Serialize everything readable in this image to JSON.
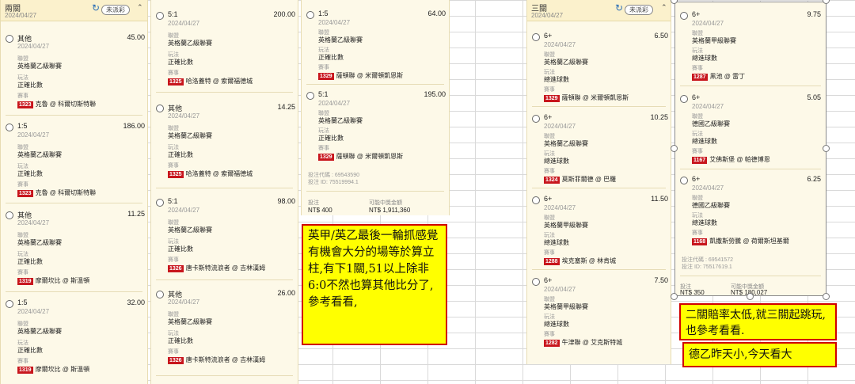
{
  "panels": [
    {
      "title": "兩關",
      "date": "2024/04/27",
      "status": "未派彩",
      "legs": [
        {
          "pick": "其他",
          "odds": "45.00",
          "date": "2024/04/27",
          "league_label": "聯盟",
          "league": "英格蘭乙級聯賽",
          "play_label": "玩法",
          "play": "正確比數",
          "match_label": "賽事",
          "match_id": "1323",
          "match": "克魯 @ 科爾切斯特聯"
        },
        {
          "pick": "1:5",
          "odds": "186.00",
          "date": "2024/04/27",
          "league_label": "聯盟",
          "league": "英格蘭乙級聯賽",
          "play_label": "玩法",
          "play": "正確比數",
          "match_label": "賽事",
          "match_id": "1323",
          "match": "克魯 @ 科爾切斯特聯"
        },
        {
          "pick": "其他",
          "odds": "11.25",
          "date": "2024/04/27",
          "league_label": "聯盟",
          "league": "英格蘭乙級聯賽",
          "play_label": "玩法",
          "play": "正確比數",
          "match_label": "賽事",
          "match_id": "1319",
          "match": "摩爾坎比 @ 斯溫頓"
        },
        {
          "pick": "1:5",
          "odds": "32.00",
          "date": "2024/04/27",
          "league_label": "聯盟",
          "league": "英格蘭乙級聯賽",
          "play_label": "玩法",
          "play": "正確比數",
          "match_label": "賽事",
          "match_id": "1319",
          "match": "摩爾坎比 @ 斯溫頓"
        }
      ]
    },
    {
      "legs": [
        {
          "pick": "5:1",
          "odds": "200.00",
          "date": "2024/04/27",
          "league_label": "聯盟",
          "league": "英格蘭乙級聯賽",
          "play_label": "玩法",
          "play": "正確比數",
          "match_label": "賽事",
          "match_id": "1325",
          "match": "哈洛蓋特 @ 索爾福德城"
        },
        {
          "pick": "其他",
          "odds": "14.25",
          "date": "2024/04/27",
          "league_label": "聯盟",
          "league": "英格蘭乙級聯賽",
          "play_label": "玩法",
          "play": "正確比數",
          "match_label": "賽事",
          "match_id": "1325",
          "match": "哈洛蓋特 @ 索爾福德城"
        },
        {
          "pick": "5:1",
          "odds": "98.00",
          "date": "2024/04/27",
          "league_label": "聯盟",
          "league": "英格蘭乙級聯賽",
          "play_label": "玩法",
          "play": "正確比數",
          "match_label": "賽事",
          "match_id": "1326",
          "match": "唐卡斯特流浪者 @ 吉林漢姆"
        },
        {
          "pick": "其他",
          "odds": "26.00",
          "date": "2024/04/27",
          "league_label": "聯盟",
          "league": "英格蘭乙級聯賽",
          "play_label": "玩法",
          "play": "正確比數",
          "match_label": "賽事",
          "match_id": "1326",
          "match": "唐卡斯特流浪者 @ 吉林漢姆"
        }
      ]
    },
    {
      "legs": [
        {
          "pick": "1:5",
          "odds": "64.00",
          "date": "2024/04/27",
          "league_label": "聯盟",
          "league": "英格蘭乙級聯賽",
          "play_label": "玩法",
          "play": "正確比數",
          "match_label": "賽事",
          "match_id": "1329",
          "match": "薩頓聯 @ 米爾頓凱恩斯"
        },
        {
          "pick": "5:1",
          "odds": "195.00",
          "date": "2024/04/27",
          "league_label": "聯盟",
          "league": "英格蘭乙級聯賽",
          "play_label": "玩法",
          "play": "正確比數",
          "match_label": "賽事",
          "match_id": "1329",
          "match": "薩頓聯 @ 米爾頓凱恩斯"
        }
      ],
      "bet_code": "投注代碼 : 69543590",
      "bet_id": "投注 ID: 75519994.1",
      "stake_label": "投注",
      "stake": "NT$ 400",
      "payout_label": "可能中獎金額",
      "payout": "NT$ 1,911,360"
    },
    {
      "title": "三關",
      "date": "2024/04/27",
      "status": "未派彩",
      "legs": [
        {
          "pick": "6+",
          "odds": "6.50",
          "date": "2024/04/27",
          "league_label": "聯盟",
          "league": "英格蘭乙級聯賽",
          "play_label": "玩法",
          "play": "總進球數",
          "match_label": "賽事",
          "match_id": "1329",
          "match": "薩頓聯 @ 米爾頓凱恩斯"
        },
        {
          "pick": "6+",
          "odds": "10.25",
          "date": "2024/04/27",
          "league_label": "聯盟",
          "league": "英格蘭乙級聯賽",
          "play_label": "玩法",
          "play": "總進球數",
          "match_label": "賽事",
          "match_id": "1324",
          "match": "莫斯菲爾德 @ 巴羅"
        },
        {
          "pick": "6+",
          "odds": "11.50",
          "date": "2024/04/27",
          "league_label": "聯盟",
          "league": "英格蘭甲級聯賽",
          "play_label": "玩法",
          "play": "總進球數",
          "match_label": "賽事",
          "match_id": "1288",
          "match": "埃克塞斯 @ 林肯城"
        },
        {
          "pick": "6+",
          "odds": "7.50",
          "date": "2024/04/27",
          "league_label": "聯盟",
          "league": "英格蘭甲級聯賽",
          "play_label": "玩法",
          "play": "總進球數",
          "match_label": "賽事",
          "match_id": "1282",
          "match": "牛津聯 @ 艾克斯特城"
        }
      ]
    },
    {
      "legs": [
        {
          "pick": "6+",
          "odds": "9.75",
          "date": "2024/04/27",
          "league_label": "聯盟",
          "league": "英格蘭甲級聯賽",
          "play_label": "玩法",
          "play": "總進球數",
          "match_label": "賽事",
          "match_id": "1287",
          "match": "黑池 @ 雷丁"
        },
        {
          "pick": "6+",
          "odds": "5.05",
          "date": "2024/04/27",
          "league_label": "聯盟",
          "league": "德國乙級聯賽",
          "play_label": "玩法",
          "play": "總進球數",
          "match_label": "賽事",
          "match_id": "1167",
          "match": "艾佛斯堡 @ 帕德博恩"
        },
        {
          "pick": "6+",
          "odds": "6.25",
          "date": "2024/04/27",
          "league_label": "聯盟",
          "league": "德國乙級聯賽",
          "play_label": "玩法",
          "play": "總進球數",
          "match_label": "賽事",
          "match_id": "1168",
          "match": "凱撒斯勞騰 @ 荷爾斯坦基爾"
        }
      ],
      "bet_code": "投注代碼 : 69541572",
      "bet_id": "投注 ID: 75517619.1",
      "stake_label": "投注",
      "stake": "NT$ 350",
      "payout_label": "可能中獎金額",
      "payout": "NT$ 180,027"
    }
  ],
  "notes": {
    "left": "英甲/英乙最後一輪抓感覺有機會大分的場等於算立柱,有下1關,51以上除非6:0不然也算其他比分了,參考看看,",
    "right_top": "二關賠率太低,就三關起跳玩,也參考看看.",
    "right_bottom": "德乙昨天小,今天看大"
  },
  "colors": {
    "panel_bg": "#fdf9e8",
    "match_badge": "#c8161d",
    "note_bg": "#ffff00",
    "note_border": "#d00000"
  }
}
